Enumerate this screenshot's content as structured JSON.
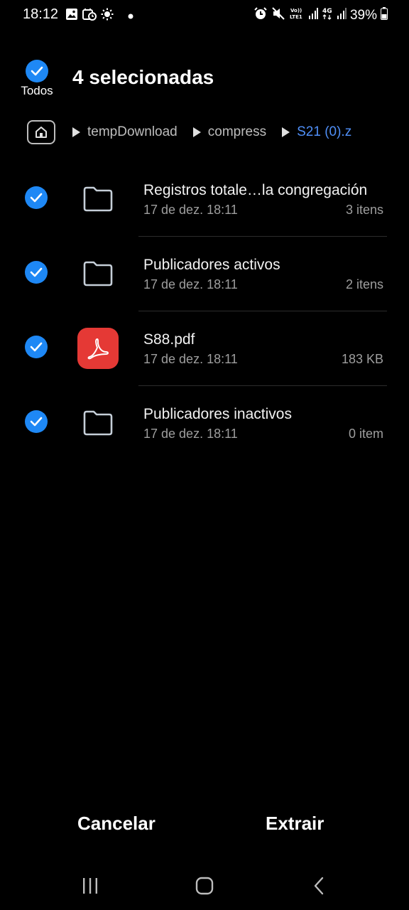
{
  "status_bar": {
    "time": "18:12",
    "left_icons": [
      "image-icon",
      "alarm-clock-icon",
      "brightness-icon",
      "dot-icon"
    ],
    "right_icons": [
      "alarm-icon",
      "mute-icon",
      "volte-icon",
      "signal-icon",
      "4g-icon",
      "signal-icon-2"
    ],
    "volte_label": "Vo)) LTE1",
    "network_label": "4G",
    "battery": "39%"
  },
  "header": {
    "select_all_label": "Todos",
    "title": "4 selecionadas"
  },
  "breadcrumb": {
    "home_icon": "home-icon",
    "items": [
      "tempDownload",
      "compress",
      "S21 (0).z"
    ],
    "active_color": "#4f8ff7"
  },
  "files": [
    {
      "name": "Registros totale…la congregación",
      "date": "17 de dez. 18:11",
      "size": "3 itens",
      "type": "folder",
      "checked": true
    },
    {
      "name": "Publicadores activos",
      "date": "17 de dez. 18:11",
      "size": "2 itens",
      "type": "folder",
      "checked": true
    },
    {
      "name": "S88.pdf",
      "date": "17 de dez. 18:11",
      "size": "183 KB",
      "type": "pdf",
      "checked": true
    },
    {
      "name": "Publicadores inactivos",
      "date": "17 de dez. 18:11",
      "size": "0 item",
      "type": "folder",
      "checked": true
    }
  ],
  "actions": {
    "cancel": "Cancelar",
    "extract": "Extrair"
  },
  "nav": [
    "recent-apps-icon",
    "home-button-icon",
    "back-icon"
  ],
  "colors": {
    "accent": "#1e88f5",
    "pdf_red": "#e53935",
    "background": "#000000"
  }
}
